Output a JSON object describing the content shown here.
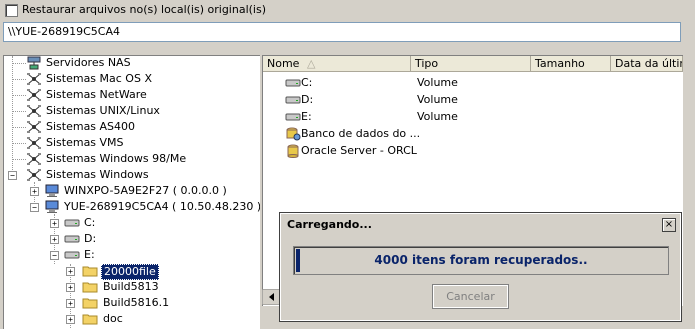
{
  "restore_checkbox": {
    "label": "Restaurar arquivos no(s) local(is) original(is)"
  },
  "path": {
    "value": "\\\\YUE-268919C5CA4"
  },
  "tree": {
    "items": [
      {
        "label": "Servidores NAS",
        "icon": "network-icon"
      },
      {
        "label": "Sistemas Mac OS X",
        "icon": "network-icon"
      },
      {
        "label": "Sistemas NetWare",
        "icon": "network-icon"
      },
      {
        "label": "Sistemas UNIX/Linux",
        "icon": "network-icon"
      },
      {
        "label": "Sistemas AS400",
        "icon": "network-icon"
      },
      {
        "label": "Sistemas VMS",
        "icon": "network-icon"
      },
      {
        "label": "Sistemas Windows 98/Me",
        "icon": "network-icon"
      },
      {
        "label": "Sistemas Windows",
        "icon": "network-icon"
      },
      {
        "label": "WINXPO-5A9E2F27 ( 0.0.0.0 )",
        "icon": "computer-icon"
      },
      {
        "label": "YUE-268919C5CA4 ( 10.50.48.230 )",
        "icon": "computer-icon"
      },
      {
        "label": "C:",
        "icon": "drive-icon"
      },
      {
        "label": "D:",
        "icon": "drive-icon"
      },
      {
        "label": "E:",
        "icon": "drive-icon"
      },
      {
        "label": "20000file",
        "icon": "folder-icon"
      },
      {
        "label": "Build5813",
        "icon": "folder-icon"
      },
      {
        "label": "Build5816.1",
        "icon": "folder-icon"
      },
      {
        "label": "doc",
        "icon": "folder-icon"
      }
    ]
  },
  "list": {
    "columns": [
      "Nome",
      "Tipo",
      "Tamanho",
      "Data da última"
    ],
    "rows": [
      {
        "name": "C:",
        "type": "Volume",
        "icon": "drive-icon"
      },
      {
        "name": "D:",
        "type": "Volume",
        "icon": "drive-icon"
      },
      {
        "name": "E:",
        "type": "Volume",
        "icon": "drive-icon"
      },
      {
        "name": "Banco de dados do ...",
        "type": "",
        "icon": "database-icon"
      },
      {
        "name": "Oracle Server - ORCL",
        "type": "",
        "icon": "oracle-icon"
      }
    ]
  },
  "dialog": {
    "title": "Carregando...",
    "close": "×",
    "message": "4000 itens foram recuperados..",
    "cancel_label": "Cancelar"
  },
  "colors": {
    "selection": "#0a246a",
    "progress_text": "#0a246a",
    "face": "#d4d0c8"
  }
}
